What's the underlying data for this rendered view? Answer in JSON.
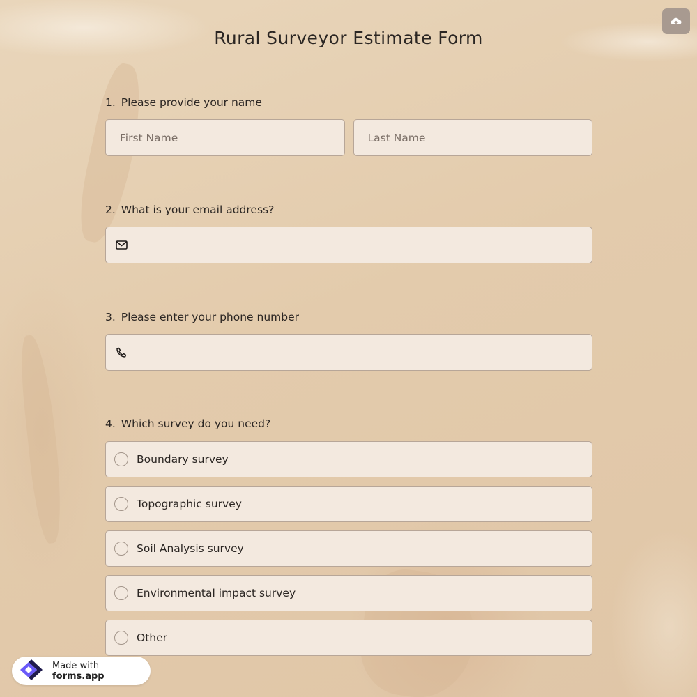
{
  "form": {
    "title": "Rural Surveyor Estimate Form"
  },
  "questions": [
    {
      "number": "1.",
      "label": "Please provide your name",
      "fields": [
        {
          "placeholder": "First Name",
          "value": ""
        },
        {
          "placeholder": "Last Name",
          "value": ""
        }
      ]
    },
    {
      "number": "2.",
      "label": "What is your email address?",
      "icon": "envelope-icon",
      "value": ""
    },
    {
      "number": "3.",
      "label": "Please enter your phone number",
      "icon": "phone-icon",
      "value": ""
    },
    {
      "number": "4.",
      "label": "Which survey do you need?",
      "options": [
        "Boundary survey",
        "Topographic survey",
        "Soil Analysis survey",
        "Environmental impact survey",
        "Other"
      ],
      "selected": null
    }
  ],
  "toolbar": {
    "upload_icon": "cloud-upload-icon"
  },
  "badge": {
    "prefix": "Made with",
    "brand": "forms.app",
    "logo_icon": "forms-app-logo-icon"
  },
  "colors": {
    "background": "#e4cdae",
    "field_bg": "#f3e9df",
    "field_border": "#b7a698",
    "upload_button": "#a89a90",
    "logo_primary": "#6a5af9",
    "logo_dark": "#1f1b4d"
  }
}
